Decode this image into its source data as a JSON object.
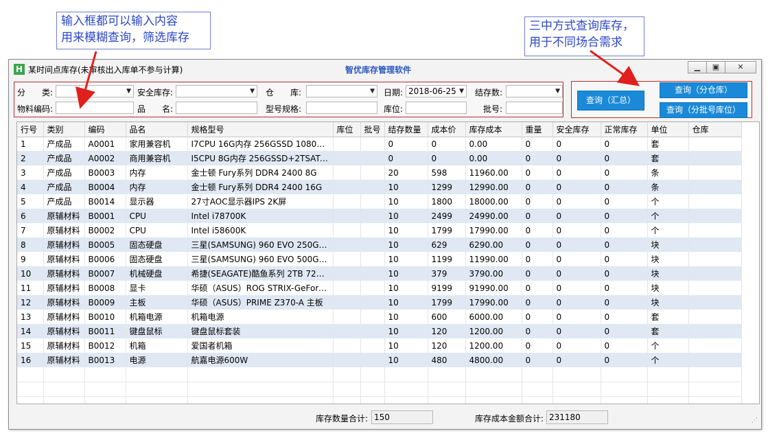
{
  "annotations": {
    "left_line1": "输入框都可以输入内容",
    "left_line2": "用来模糊查询，筛选库存",
    "right_line1": "三中方式查询库存，",
    "right_line2": "用于不同场合需求"
  },
  "window": {
    "title": "某时间点库存(未审核出入库单不参与计算)",
    "app_name": "智优库存管理软件",
    "icon_letter": "H"
  },
  "filters": {
    "category_label": "分　　类:",
    "safety_stock_label": "安全库存:",
    "warehouse_label": "仓　　库:",
    "date_label": "日期:",
    "date_value": "2018-06-25",
    "balance_label": "结存数:",
    "material_code_label": "物料编码:",
    "product_name_label": "品　　名:",
    "model_spec_label": "型号规格:",
    "location_label": "库位:",
    "batch_label": "批号:"
  },
  "buttons": {
    "query_summary": "查询（汇总）",
    "query_by_warehouse": "查询（分仓库）",
    "query_by_batch_location": "查询（分批号库位）"
  },
  "table": {
    "columns": [
      "行号",
      "类别",
      "编码",
      "品名",
      "规格型号",
      "库位",
      "批号",
      "结存数量",
      "成本价",
      "库存成本",
      "重量",
      "安全库存",
      "正常库存",
      "单位",
      "仓库"
    ],
    "rows": [
      [
        "1",
        "产成品",
        "A0001",
        "家用兼容机",
        "I7CPU 16G内存 256GSSD 1080显卡",
        "",
        "",
        "0",
        "0",
        "0.00",
        "0",
        "0",
        "0",
        "套",
        ""
      ],
      [
        "2",
        "产成品",
        "A0002",
        "商用兼容机",
        "I5CPU 8G内存 256GSSD+2TSATA...",
        "",
        "",
        "0",
        "0",
        "0.00",
        "0",
        "0",
        "0",
        "套",
        ""
      ],
      [
        "3",
        "产成品",
        "B0003",
        "内存",
        "金士顿 Fury系列 DDR4 2400 8G",
        "",
        "",
        "20",
        "598",
        "11960.00",
        "0",
        "0",
        "0",
        "条",
        ""
      ],
      [
        "4",
        "产成品",
        "B0004",
        "内存",
        "金士顿 Fury系列 DDR4 2400 16G",
        "",
        "",
        "10",
        "1299",
        "12990.00",
        "0",
        "0",
        "0",
        "条",
        ""
      ],
      [
        "5",
        "产成品",
        "B0014",
        "显示器",
        "27寸AOC显示器IPS 2K屏",
        "",
        "",
        "10",
        "1800",
        "18000.00",
        "0",
        "0",
        "0",
        "个",
        ""
      ],
      [
        "6",
        "原辅材料",
        "B0001",
        "CPU",
        "Intel i78700K",
        "",
        "",
        "10",
        "2499",
        "24990.00",
        "0",
        "0",
        "0",
        "个",
        ""
      ],
      [
        "7",
        "原辅材料",
        "B0002",
        "CPU",
        "Intel i58600K",
        "",
        "",
        "10",
        "1799",
        "17990.00",
        "0",
        "0",
        "0",
        "个",
        ""
      ],
      [
        "8",
        "原辅材料",
        "B0005",
        "固态硬盘",
        "三星(SAMSUNG) 960 EVO 250G ...",
        "",
        "",
        "10",
        "629",
        "6290.00",
        "0",
        "0",
        "0",
        "块",
        ""
      ],
      [
        "9",
        "原辅材料",
        "B0006",
        "固态硬盘",
        "三星(SAMSUNG) 960 EVO 500G ...",
        "",
        "",
        "10",
        "1199",
        "11990.00",
        "0",
        "0",
        "0",
        "块",
        ""
      ],
      [
        "10",
        "原辅材料",
        "B0007",
        "机械硬盘",
        "希捷(SEAGATE)酷鱼系列 2TB 7200...",
        "",
        "",
        "10",
        "379",
        "3790.00",
        "0",
        "0",
        "0",
        "块",
        ""
      ],
      [
        "11",
        "原辅材料",
        "B0008",
        "显卡",
        "华硕（ASUS）ROG STRIX-GeForc...",
        "",
        "",
        "10",
        "9199",
        "91990.00",
        "0",
        "0",
        "0",
        "块",
        ""
      ],
      [
        "12",
        "原辅材料",
        "B0009",
        "主板",
        "华硕（ASUS）PRIME Z370-A 主板",
        "",
        "",
        "10",
        "1799",
        "17990.00",
        "0",
        "0",
        "0",
        "块",
        ""
      ],
      [
        "13",
        "原辅材料",
        "B0010",
        "机箱电源",
        "机箱电源",
        "",
        "",
        "10",
        "600",
        "6000.00",
        "0",
        "0",
        "0",
        "套",
        ""
      ],
      [
        "14",
        "原辅材料",
        "B0011",
        "键盘鼠标",
        "键盘鼠标套装",
        "",
        "",
        "10",
        "120",
        "1200.00",
        "0",
        "0",
        "0",
        "套",
        ""
      ],
      [
        "15",
        "原辅材料",
        "B0012",
        "机箱",
        "爱国者机箱",
        "",
        "",
        "10",
        "120",
        "1200.00",
        "0",
        "0",
        "0",
        "个",
        ""
      ],
      [
        "16",
        "原辅材料",
        "B0013",
        "电源",
        "航嘉电源600W",
        "",
        "",
        "10",
        "480",
        "4800.00",
        "0",
        "0",
        "0",
        "个",
        ""
      ]
    ]
  },
  "footer": {
    "qty_total_label": "库存数量合计:",
    "qty_total_value": "150",
    "cost_total_label": "库存成本金额合计:",
    "cost_total_value": "231180"
  }
}
